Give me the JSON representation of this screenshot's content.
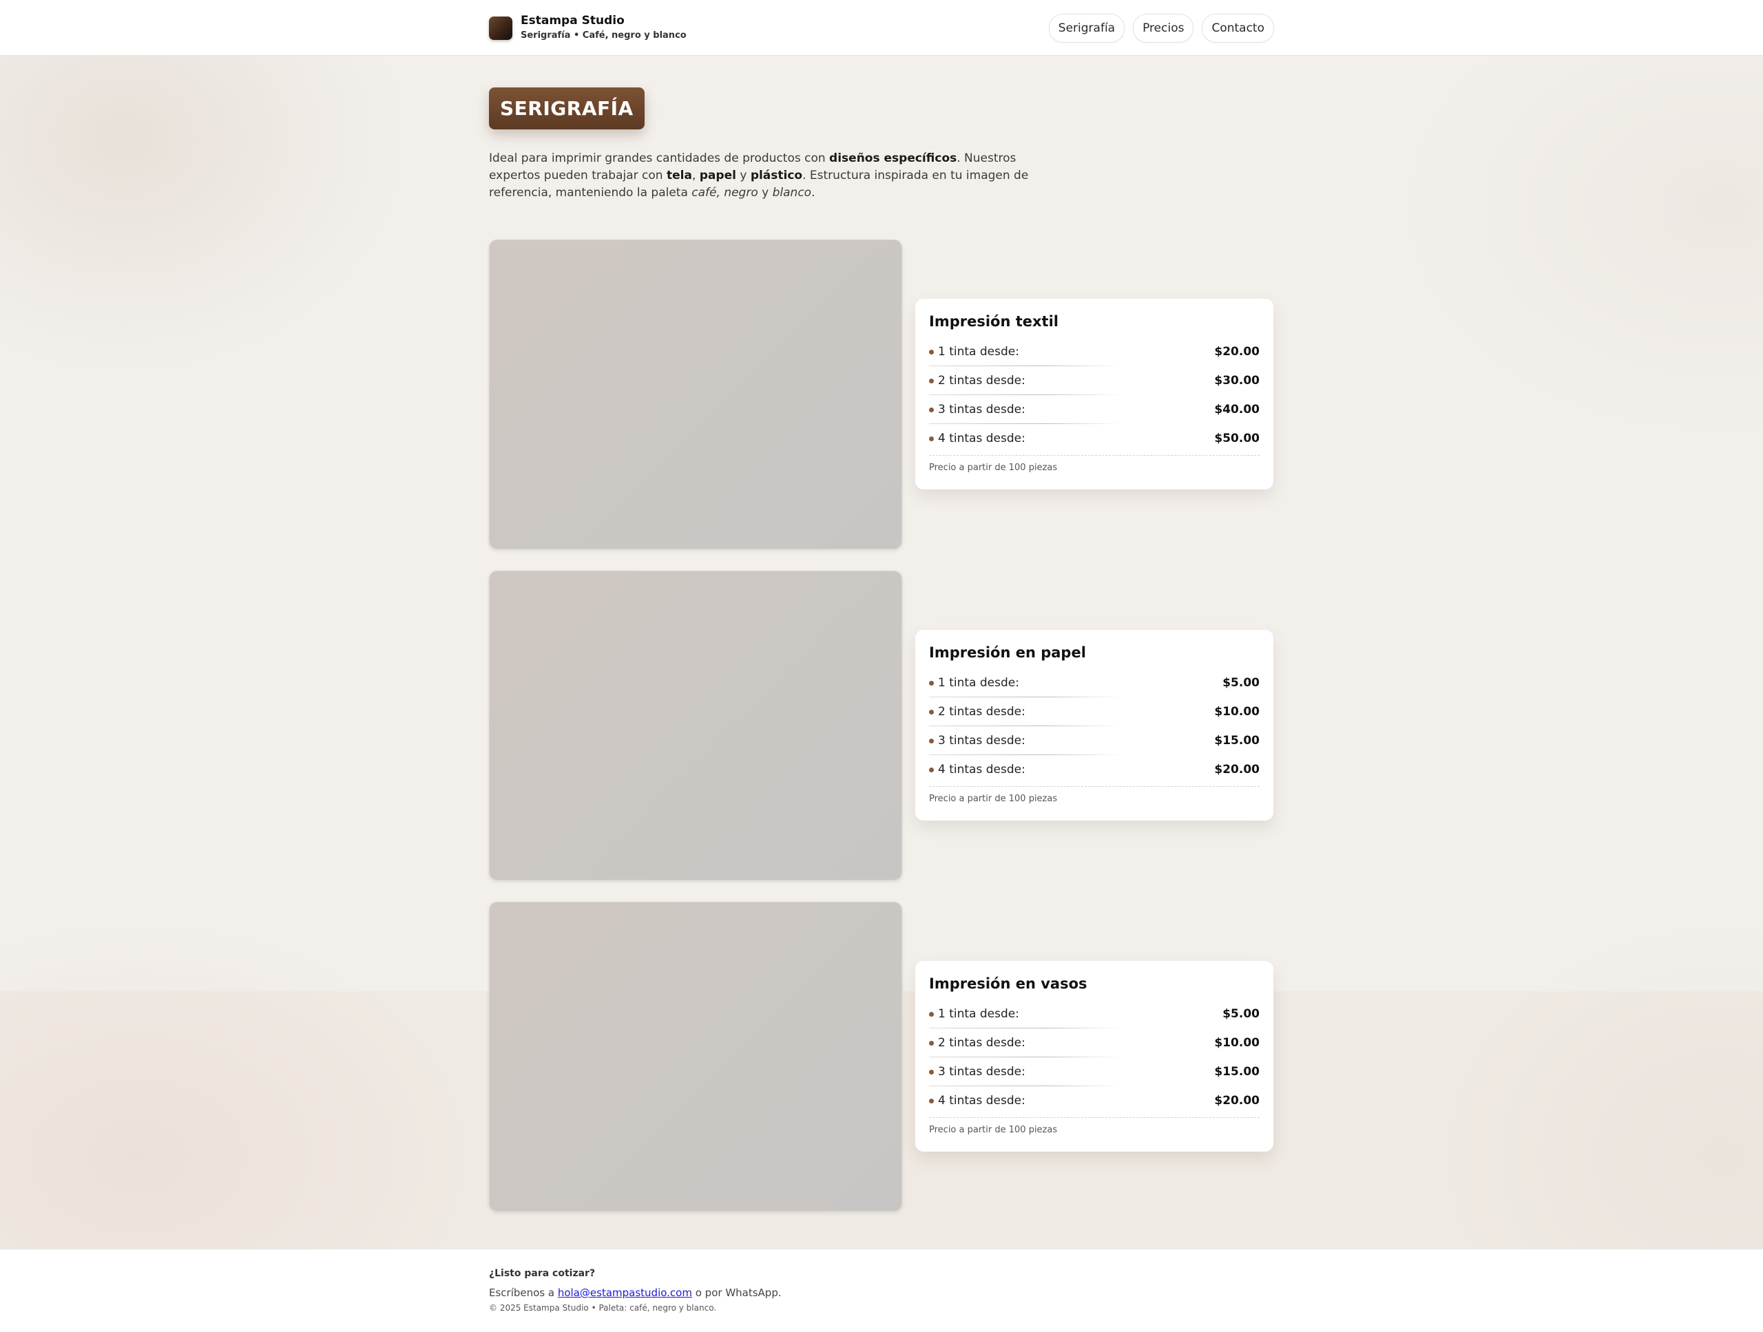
{
  "header": {
    "brand_name": "Estampa Studio",
    "brand_sub": "Serigrafía • Café, negro y blanco",
    "nav": [
      "Serigrafía",
      "Precios",
      "Contacto"
    ]
  },
  "hero": {
    "badge": "SERIGRAFÍA",
    "intro": {
      "p1": "Ideal para imprimir grandes cantidades de productos con ",
      "b1": "diseños específicos",
      "p2": ". Nuestros expertos pueden trabajar con ",
      "b2": "tela",
      "p3": ", ",
      "b3": "papel",
      "p4": " y ",
      "b4": "plástico",
      "p5": ". Estructura inspirada en tu imagen de referencia, manteniendo la paleta ",
      "i1": "café, negro",
      "p6": " y ",
      "i2": "blanco",
      "p7": "."
    }
  },
  "services": [
    {
      "title": "Impresión textil",
      "rows": [
        {
          "label": "1 tinta desde:",
          "price": "$20.00"
        },
        {
          "label": "2 tintas desde:",
          "price": "$30.00"
        },
        {
          "label": "3 tintas desde:",
          "price": "$40.00"
        },
        {
          "label": "4 tintas desde:",
          "price": "$50.00"
        }
      ],
      "note": "Precio a partir de 100 piezas"
    },
    {
      "title": "Impresión en papel",
      "rows": [
        {
          "label": "1 tinta desde:",
          "price": "$5.00"
        },
        {
          "label": "2 tintas desde:",
          "price": "$10.00"
        },
        {
          "label": "3 tintas desde:",
          "price": "$15.00"
        },
        {
          "label": "4 tintas desde:",
          "price": "$20.00"
        }
      ],
      "note": "Precio a partir de 100 piezas"
    },
    {
      "title": "Impresión en vasos",
      "rows": [
        {
          "label": "1 tinta desde:",
          "price": "$5.00"
        },
        {
          "label": "2 tintas desde:",
          "price": "$10.00"
        },
        {
          "label": "3 tintas desde:",
          "price": "$15.00"
        },
        {
          "label": "4 tintas desde:",
          "price": "$20.00"
        }
      ],
      "note": "Precio a partir de 100 piezas"
    }
  ],
  "footer": {
    "title": "¿Listo para cotizar?",
    "pre": "Escríbenos a ",
    "email": "hola@estampastudio.com",
    "post": " o por WhatsApp.",
    "copy": "© 2025 Estampa Studio • Paleta: café, negro y blanco."
  },
  "colors": {
    "accent": "#6b4429",
    "bullet": "#8a5a36",
    "background": "#f3f0ec"
  }
}
